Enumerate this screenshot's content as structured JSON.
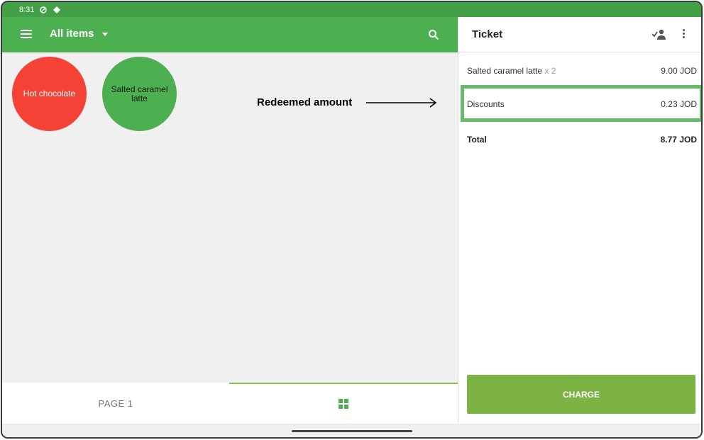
{
  "status_bar": {
    "time": "8:31"
  },
  "toolbar": {
    "title": "All items"
  },
  "items": [
    {
      "name": "Hot chocolate",
      "color": "#f44336"
    },
    {
      "name": "Salted caramel latte",
      "color": "#4caf50"
    }
  ],
  "annotation": {
    "label": "Redeemed amount"
  },
  "pager": {
    "page_label": "PAGE 1"
  },
  "ticket": {
    "title": "Ticket",
    "line_item": {
      "name": "Salted caramel latte",
      "qty": "x 2",
      "amount": "9.00 JOD"
    },
    "discount": {
      "label": "Discounts",
      "amount": "0.23 JOD"
    },
    "total": {
      "label": "Total",
      "amount": "8.77 JOD"
    },
    "charge_label": "CHARGE"
  },
  "colors": {
    "primary": "#4caf50",
    "status_bar": "#43a047",
    "charge": "#7cb342",
    "highlight": "#66bb6a",
    "hot_chocolate": "#f44336"
  }
}
